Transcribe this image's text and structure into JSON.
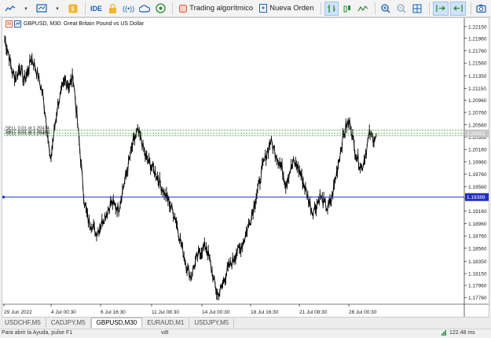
{
  "toolbar": {
    "algo_trading_label": "Trading algorítmico",
    "new_order_label": "Nueva Orden",
    "ide_label": "IDE"
  },
  "chart": {
    "header_text": "GBPUSD, M30:  Great Britain Pound vs US Dollar",
    "order_lines": [
      "SELL 0.01 at 1.20474",
      "SELL 0.01 at 1.20390",
      "SELL 0.01 at 1.20408"
    ],
    "current_price_label": "1.20421",
    "blue_line_label": "1.19389",
    "colors": {
      "candle": "#000000",
      "order_line": "#2e9a2e",
      "blue_line": "#1f2fbf",
      "price_tag": "#c8c8c8"
    }
  },
  "chart_data": {
    "type": "line",
    "price_axis_ticks": [
      "1.22150",
      "1.21960",
      "1.21760",
      "1.21560",
      "1.21350",
      "1.21150",
      "1.20960",
      "1.20760",
      "1.20560",
      "1.20360",
      "1.20160",
      "1.19960",
      "1.19760",
      "1.19560",
      "1.19370",
      "1.19160",
      "1.18960",
      "1.18760",
      "1.18560",
      "1.18350",
      "1.18150",
      "1.17960",
      "1.17760"
    ],
    "time_axis_ticks": [
      "29 Jun 2022",
      "4 Jul 00:30",
      "6 Jul 16:30",
      "11 Jul 08:30",
      "14 Jul 00:30",
      "18 Jul 16:30",
      "21 Jul 08:30",
      "26 Jul 00:30"
    ],
    "ylim": [
      1.1768,
      1.2225
    ],
    "series": [
      {
        "values": [
          1.2195,
          1.2172,
          1.214,
          1.2132,
          1.215,
          1.2128,
          1.214,
          1.2165,
          1.215,
          1.213,
          1.2105,
          1.206,
          1.1995,
          1.2045,
          1.209,
          1.211,
          1.213,
          1.2118,
          1.2135,
          1.207,
          1.2,
          1.193,
          1.19,
          1.1895,
          1.188,
          1.189,
          1.1905,
          1.1915,
          1.193,
          1.1925,
          1.192,
          1.195,
          1.1975,
          1.2005,
          1.203,
          1.2045,
          1.203,
          1.2005,
          1.1995,
          1.1985,
          1.1975,
          1.196,
          1.1945,
          1.1935,
          1.192,
          1.1905,
          1.1875,
          1.185,
          1.1825,
          1.181,
          1.183,
          1.1845,
          1.1855,
          1.186,
          1.1835,
          1.1805,
          1.178,
          1.179,
          1.181,
          1.1825,
          1.1835,
          1.185,
          1.1855,
          1.187,
          1.189,
          1.191,
          1.1935,
          1.196,
          1.199,
          1.201,
          1.203,
          1.2015,
          1.2,
          1.1985,
          1.196,
          1.198,
          1.1995,
          1.199,
          1.1975,
          1.1955,
          1.1935,
          1.1915,
          1.1925,
          1.194,
          1.193,
          1.192,
          1.1935,
          1.1965,
          1.2,
          1.2035,
          1.2055,
          1.206,
          1.202,
          1.2,
          1.1985,
          1.201,
          1.204,
          1.2035
        ]
      }
    ]
  },
  "tabs": [
    "USDCHF,M5",
    "CADJPY,M5",
    "GBPUSD,M30",
    "EURAUD,M1",
    "USDJPY,M5"
  ],
  "active_tab": "GBPUSD,M30",
  "status": {
    "help": "Para abrir la Ayuda, pulse F1",
    "profile": "vdt",
    "ping": "122.48 ms"
  }
}
